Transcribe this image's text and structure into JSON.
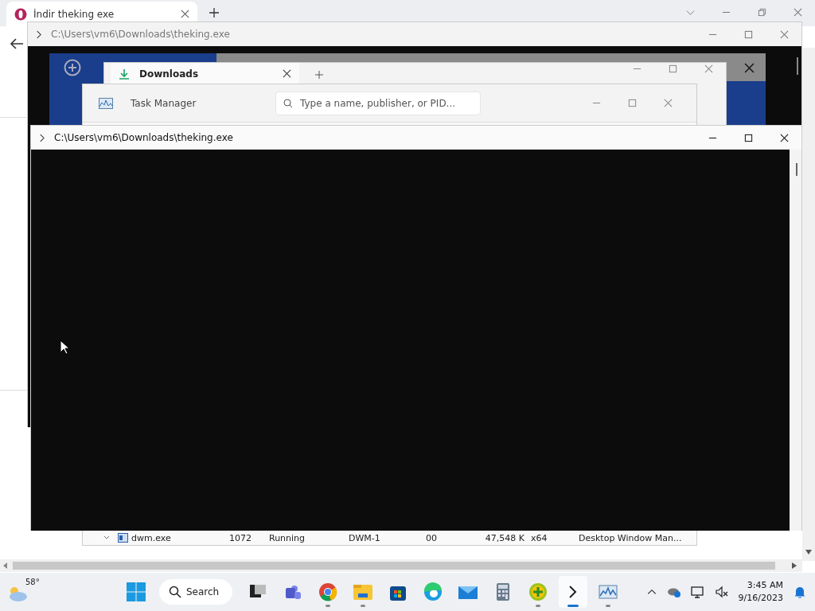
{
  "browser": {
    "tab": {
      "title": "İndir theking exe",
      "selected": true
    }
  },
  "terminal_back": {
    "title": "C:\\Users\\vm6\\Downloads\\theking.exe"
  },
  "downloads": {
    "title": "Downloads"
  },
  "task_manager": {
    "title": "Task Manager",
    "search": {
      "placeholder": "Type a name, publisher, or PID..."
    },
    "row": {
      "name": "dwm.exe",
      "pid": "1072",
      "status": "Running",
      "user": "DWM-1",
      "cpu": "00",
      "memory": "47,548 K",
      "arch": "x64",
      "description": "Desktop Window Man..."
    }
  },
  "terminal_front": {
    "title": "C:\\Users\\vm6\\Downloads\\theking.exe"
  },
  "taskbar": {
    "weather": "58°",
    "search": "Search",
    "apps": [
      {
        "running": false,
        "active": false
      },
      {
        "running": false,
        "active": false
      },
      {
        "running": true,
        "active": false
      },
      {
        "running": true,
        "active": false
      },
      {
        "running": false,
        "active": false
      },
      {
        "running": false,
        "active": false
      },
      {
        "running": false,
        "active": false
      },
      {
        "running": false,
        "active": false
      },
      {
        "running": true,
        "active": false
      },
      {
        "running": true,
        "active": true
      },
      {
        "running": true,
        "active": false
      }
    ],
    "time": "3:45 AM",
    "date": "9/16/2023"
  }
}
